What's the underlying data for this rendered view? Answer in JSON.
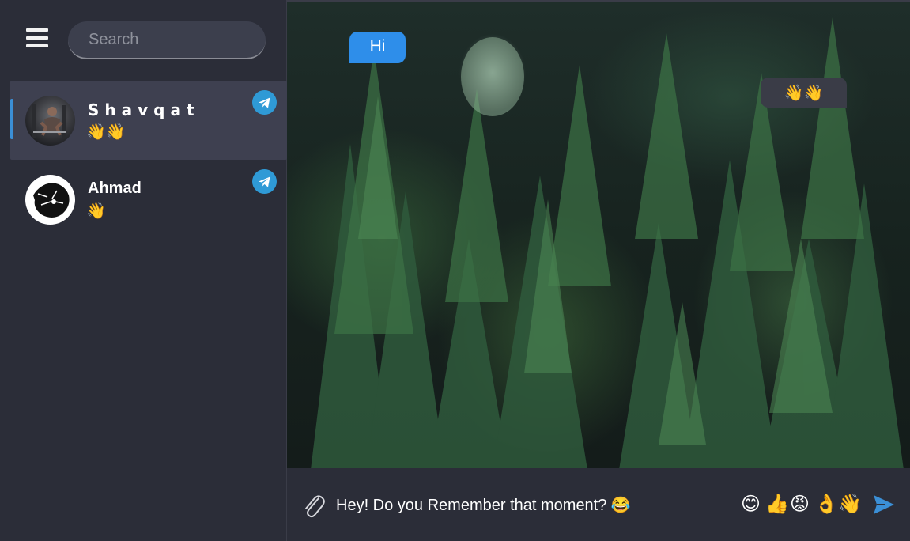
{
  "search": {
    "placeholder": "Search"
  },
  "chats": [
    {
      "name": "Shavqat",
      "preview": "👋👋",
      "active": true
    },
    {
      "name": "Ahmad",
      "preview": "👋",
      "active": false
    }
  ],
  "messages": [
    {
      "direction": "incoming",
      "text": "Hi"
    },
    {
      "direction": "outgoing",
      "text": "👋👋"
    }
  ],
  "composer": {
    "value": "Hey! Do you Remember that moment? 😂",
    "emojis": [
      "😊",
      "👍",
      "😡",
      "👌",
      "👋"
    ]
  },
  "colors": {
    "accent": "#2e8eea",
    "telegram": "#2f9ad6",
    "sidebar": "#2b2d38",
    "active_chat": "#3e4050"
  }
}
